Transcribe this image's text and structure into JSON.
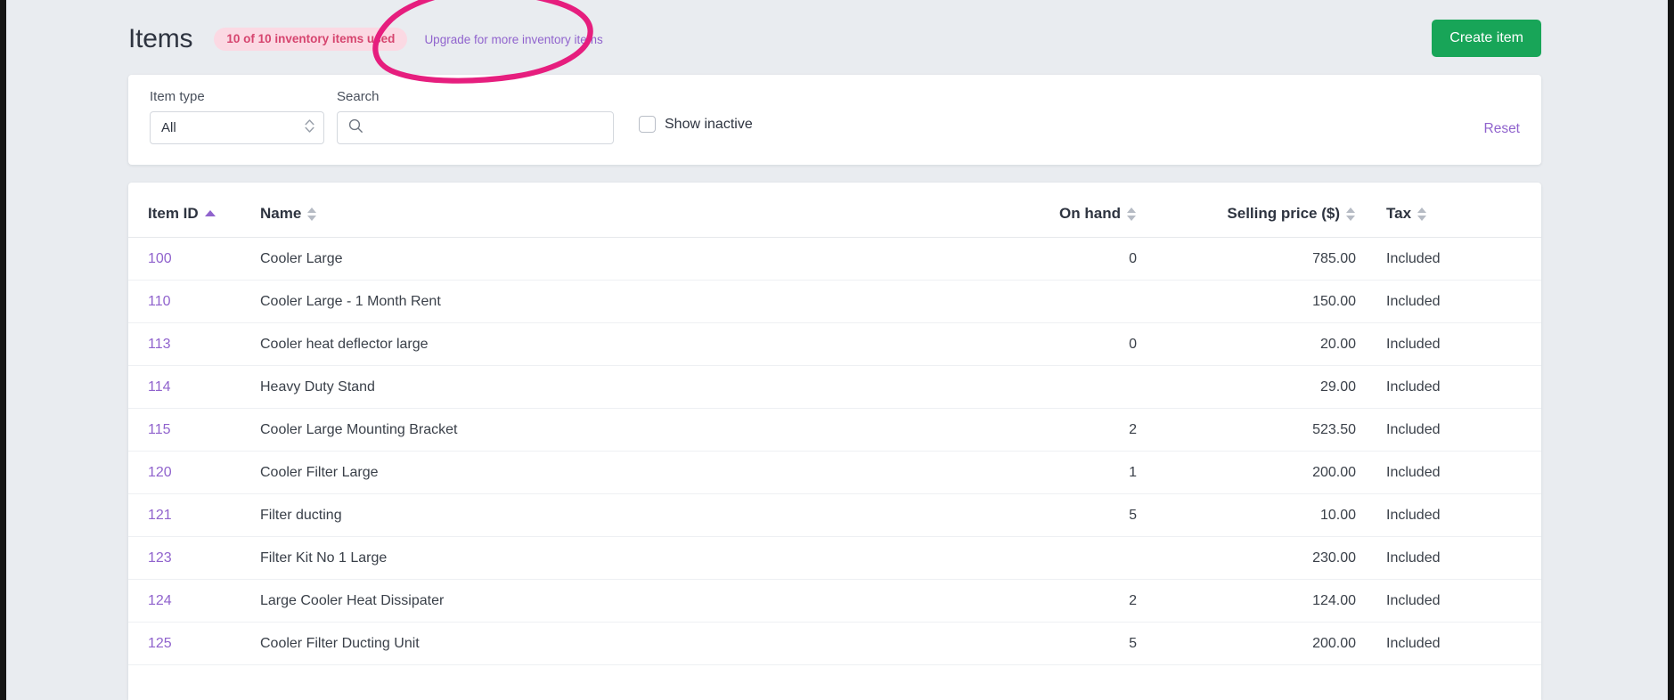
{
  "header": {
    "title": "Items",
    "badge": "10 of 10 inventory items used",
    "upgrade_link": "Upgrade for more inventory items",
    "create_button": "Create item"
  },
  "filters": {
    "item_type_label": "Item type",
    "item_type_value": "All",
    "item_type_options": [
      "All"
    ],
    "search_label": "Search",
    "search_value": "",
    "search_placeholder": "",
    "show_inactive_label": "Show inactive",
    "show_inactive_checked": "false",
    "reset_label": "Reset"
  },
  "table": {
    "columns": [
      {
        "label": "Item ID",
        "sort": "asc"
      },
      {
        "label": "Name",
        "sort": "none"
      },
      {
        "label": "On hand",
        "sort": "none"
      },
      {
        "label": "Selling price ($)",
        "sort": "none"
      },
      {
        "label": "Tax",
        "sort": "none"
      }
    ],
    "rows": [
      {
        "id": "100",
        "name": "Cooler Large",
        "on_hand": "0",
        "price": "785.00",
        "tax": "Included"
      },
      {
        "id": "110",
        "name": "Cooler Large - 1 Month Rent",
        "on_hand": "",
        "price": "150.00",
        "tax": "Included"
      },
      {
        "id": "113",
        "name": "Cooler heat deflector large",
        "on_hand": "0",
        "price": "20.00",
        "tax": "Included"
      },
      {
        "id": "114",
        "name": "Heavy Duty Stand",
        "on_hand": "",
        "price": "29.00",
        "tax": "Included"
      },
      {
        "id": "115",
        "name": "Cooler Large Mounting Bracket",
        "on_hand": "2",
        "price": "523.50",
        "tax": "Included"
      },
      {
        "id": "120",
        "name": "Cooler Filter Large",
        "on_hand": "1",
        "price": "200.00",
        "tax": "Included"
      },
      {
        "id": "121",
        "name": "Filter ducting",
        "on_hand": "5",
        "price": "10.00",
        "tax": "Included"
      },
      {
        "id": "123",
        "name": "Filter Kit No 1 Large",
        "on_hand": "",
        "price": "230.00",
        "tax": "Included"
      },
      {
        "id": "124",
        "name": "Large Cooler Heat Dissipater",
        "on_hand": "2",
        "price": "124.00",
        "tax": "Included"
      },
      {
        "id": "125",
        "name": "Cooler Filter Ducting Unit",
        "on_hand": "5",
        "price": "200.00",
        "tax": "Included"
      }
    ]
  },
  "annotation": {
    "shape": "hand-drawn-ellipse",
    "color": "#e61e7e",
    "target": "Upgrade for more inventory items"
  },
  "colors": {
    "page_background": "#e9ecf0",
    "card_background": "#ffffff",
    "accent_link": "#9063cd",
    "primary_button": "#18a558",
    "badge_background": "#fbd9e3",
    "badge_text": "#d6456f",
    "annotation": "#e61e7e"
  }
}
